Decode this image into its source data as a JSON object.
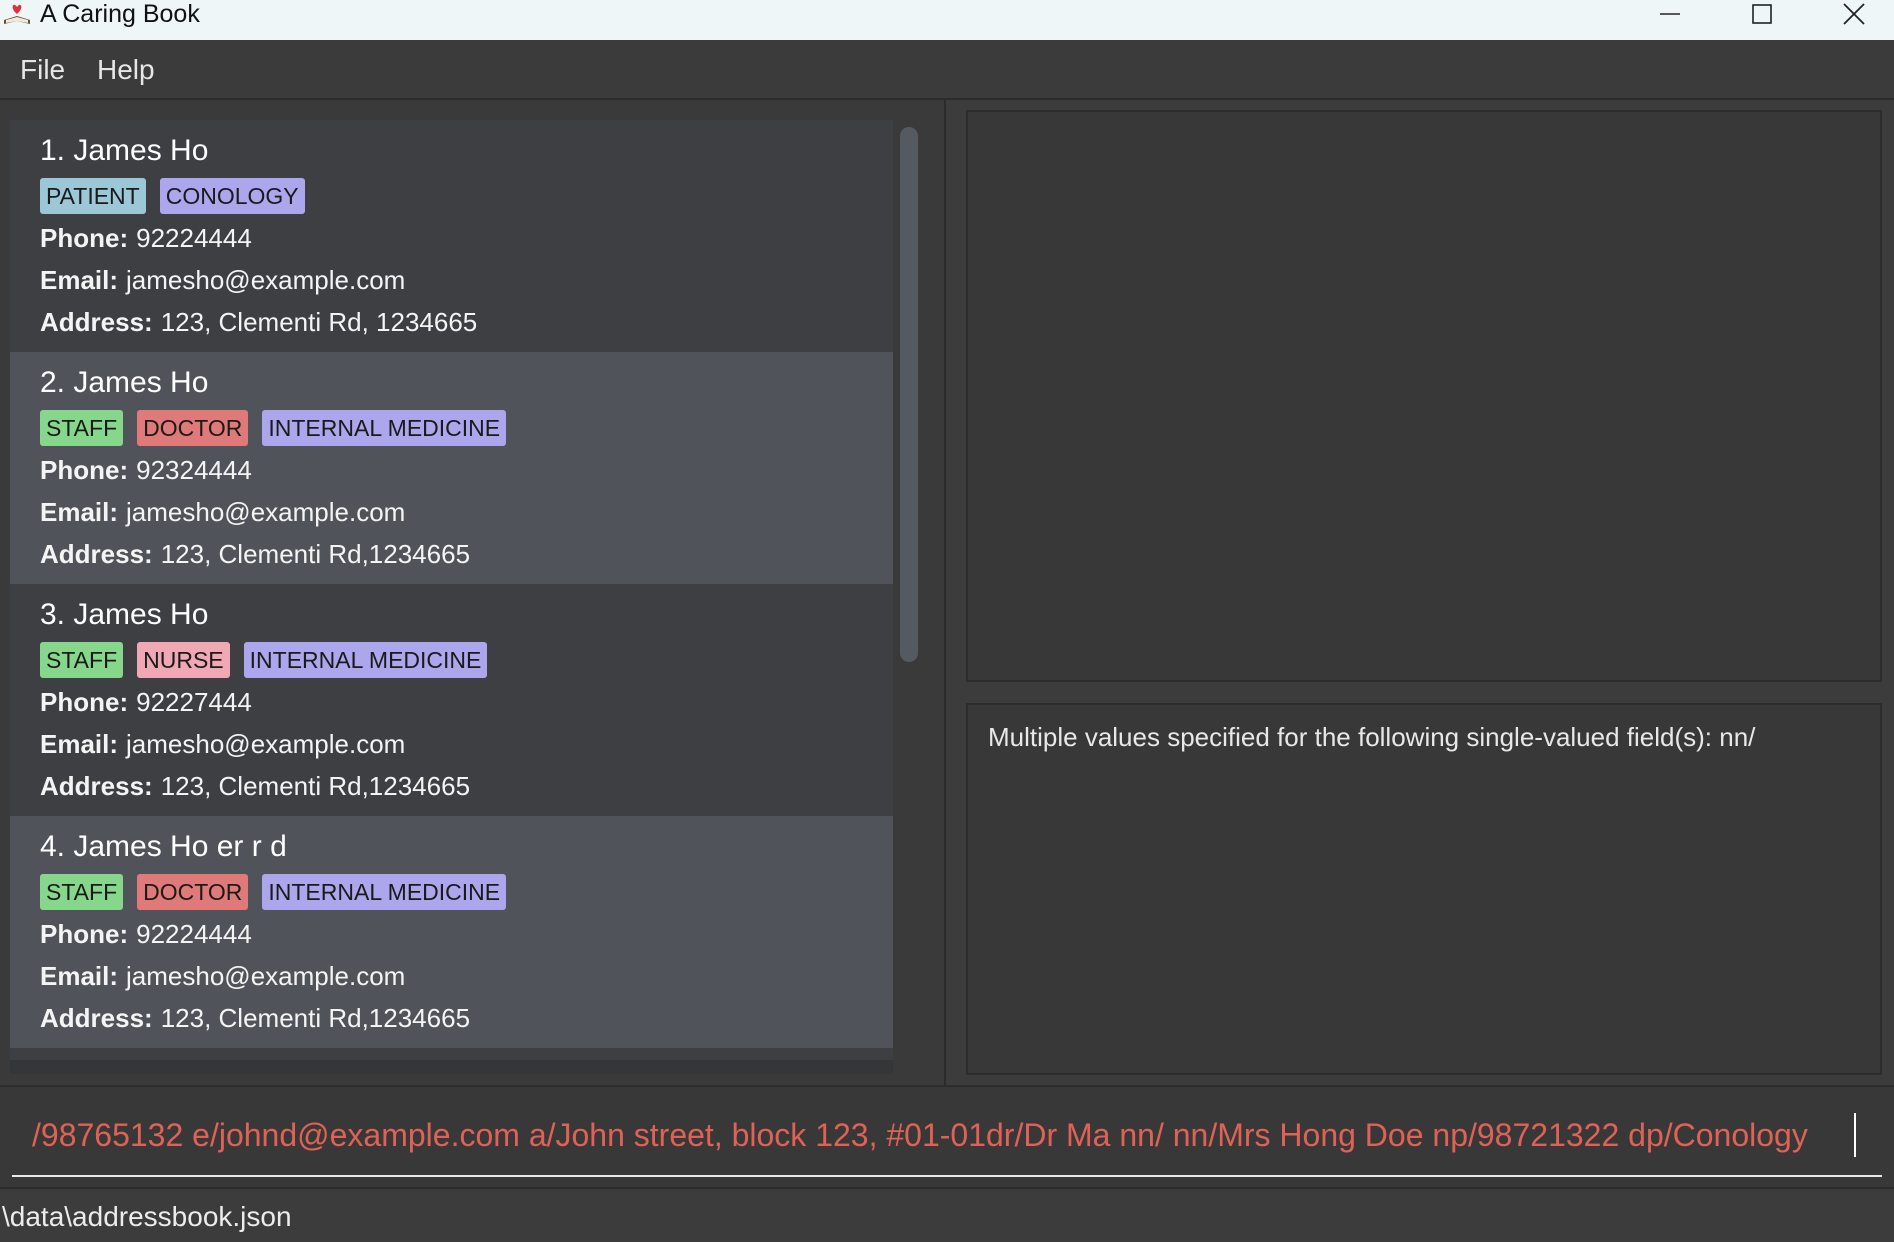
{
  "window": {
    "title": "A Caring Book",
    "icon": "book-heart-icon",
    "controls": [
      "minimize-icon",
      "maximize-icon",
      "close-icon"
    ]
  },
  "menu": {
    "file_label": "File",
    "help_label": "Help"
  },
  "persons": [
    {
      "name": "1. James Ho",
      "tags": [
        {
          "label": "PATIENT",
          "color": "#9cc7d6"
        },
        {
          "label": "CONOLOGY",
          "color": "#aca7ec"
        }
      ],
      "phone_label": "Phone:",
      "phone": "92224444",
      "email_label": "Email:",
      "email": "jamesho@example.com",
      "address_label": "Address:",
      "address": "123, Clementi Rd, 1234665"
    },
    {
      "name": "2. James Ho",
      "tags": [
        {
          "label": "STAFF",
          "color": "#86d68c"
        },
        {
          "label": "DOCTOR",
          "color": "#e07a7a"
        },
        {
          "label": "INTERNAL MEDICINE",
          "color": "#aca7ec"
        }
      ],
      "phone_label": "Phone:",
      "phone": "92324444",
      "email_label": "Email:",
      "email": "jamesho@example.com",
      "address_label": "Address:",
      "address": "123, Clementi Rd,1234665"
    },
    {
      "name": "3. James Ho",
      "tags": [
        {
          "label": "STAFF",
          "color": "#86d68c"
        },
        {
          "label": "NURSE",
          "color": "#f0a8b4"
        },
        {
          "label": "INTERNAL MEDICINE",
          "color": "#aca7ec"
        }
      ],
      "phone_label": "Phone:",
      "phone": "92227444",
      "email_label": "Email:",
      "email": "jamesho@example.com",
      "address_label": "Address:",
      "address": "123, Clementi Rd,1234665"
    },
    {
      "name": "4. James Ho er r d",
      "tags": [
        {
          "label": "STAFF",
          "color": "#86d68c"
        },
        {
          "label": "DOCTOR",
          "color": "#e07a7a"
        },
        {
          "label": "INTERNAL MEDICINE",
          "color": "#aca7ec"
        }
      ],
      "phone_label": "Phone:",
      "phone": "92224444",
      "email_label": "Email:",
      "email": "jamesho@example.com",
      "address_label": "Address:",
      "address": "123, Clementi Rd,1234665"
    }
  ],
  "result_display": {
    "message": "Multiple values specified for the following single-valued field(s): nn/"
  },
  "command_box": {
    "value": "/98765132 e/johnd@example.com a/John street, block 123, #01-01dr/Dr Ma nn/ nn/Mrs Hong Doe np/98721322 dp/Conology",
    "text_color": "#e06256"
  },
  "status_bar": {
    "path": "\\data\\addressbook.json"
  }
}
